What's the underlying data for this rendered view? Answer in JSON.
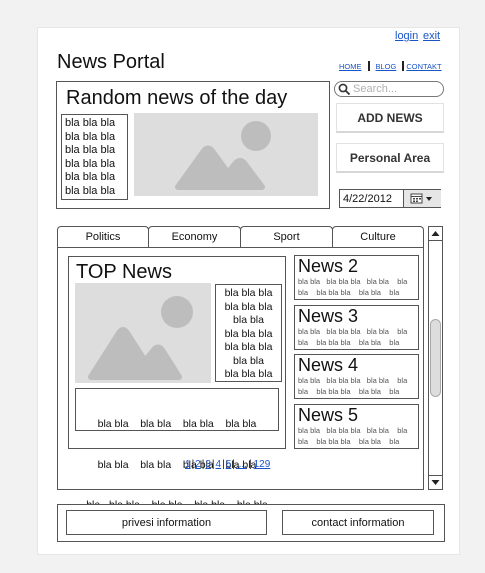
{
  "header": {
    "login": "login",
    "exit": "exit",
    "title": "News Portal",
    "nav": [
      "HOME",
      "BLOG",
      "CONTAKT"
    ]
  },
  "random": {
    "title": "Random news of the day",
    "text_lines": [
      "bla bla bla",
      "bla bla bla",
      "bla bla bla",
      "bla bla bla",
      "bla bla bla",
      "bla bla bla",
      "bla bla bla"
    ]
  },
  "search": {
    "placeholder": "Search..."
  },
  "buttons": {
    "add_news": "ADD NEWS",
    "personal_area": "Personal Area"
  },
  "date": {
    "value": "4/22/2012"
  },
  "tabs": [
    "Politics",
    "Economy",
    "Sport",
    "Culture"
  ],
  "top_news": {
    "title": "TOP News",
    "side_lines": [
      "bla bla  bla",
      "bla   bla bla",
      "bla bla",
      "bla bla  bla",
      "bla   bla bla",
      "bla bla",
      "bla bla   bla"
    ],
    "body_lines": [
      "bla bla    bla bla    bla bla    bla bla",
      "bla bla    bla bla    bla bla    bla bla",
      "bla   bla bla    bla bla    bla bla    bla bla"
    ]
  },
  "news": [
    {
      "title": "News 2",
      "lines": [
        "bla bla   bla bla bla   bla bla    bla",
        "bla    bla bla bla    bla bla    bla"
      ]
    },
    {
      "title": "News 3",
      "lines": [
        "bla bla   bla bla bla   bla bla    bla",
        "bla    bla bla bla    bla bla    bla"
      ]
    },
    {
      "title": "News 4",
      "lines": [
        "bla bla   bla bla bla   bla bla    bla",
        "bla    bla bla bla    bla bla    bla"
      ]
    },
    {
      "title": "News 5",
      "lines": [
        "bla bla   bla bla bla   bla bla    bla",
        "bla    bla bla bla    bla bla    bla"
      ]
    }
  ],
  "pagination": [
    "1",
    "2",
    "3",
    "4",
    "5",
    "....",
    "129"
  ],
  "footer": {
    "privacy": "privesi information",
    "contact": "contact information"
  },
  "icons": {
    "search": "search-icon",
    "calendar": "calendar-icon",
    "scroll_up": "arrow-up-icon",
    "scroll_down": "arrow-down-icon",
    "image": "image-placeholder-icon"
  }
}
